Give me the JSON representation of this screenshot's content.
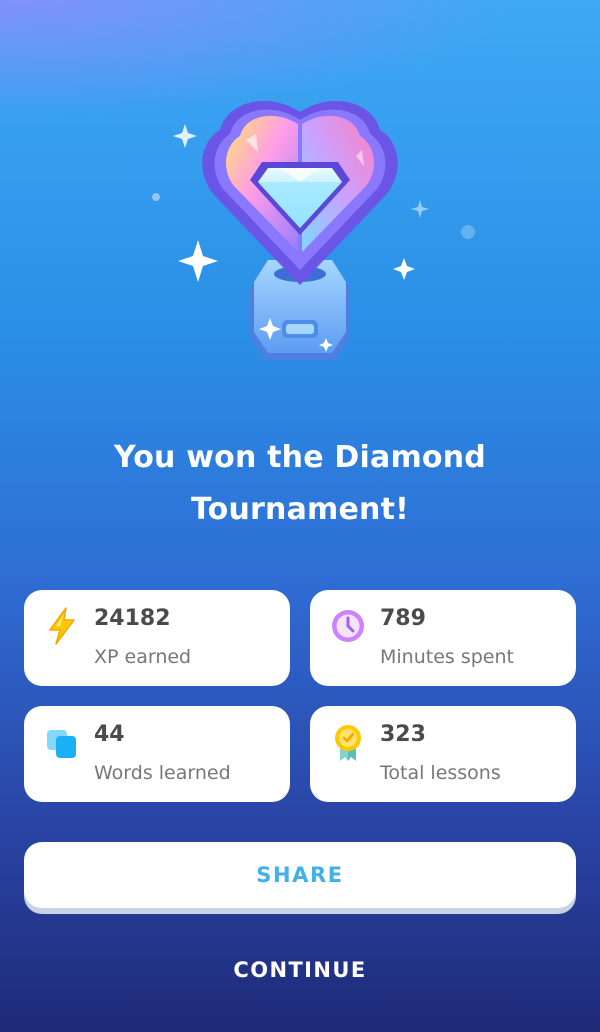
{
  "title_line1": "You won the Diamond",
  "title_line2": "Tournament!",
  "stats": [
    {
      "value": "24182",
      "label": "XP earned",
      "icon": "lightning-bolt-icon",
      "color": "#ffc800"
    },
    {
      "value": "789",
      "label": "Minutes spent",
      "icon": "clock-icon",
      "color": "#ce82ff"
    },
    {
      "value": "44",
      "label": "Words learned",
      "icon": "cards-icon",
      "color": "#1cb0f6"
    },
    {
      "value": "323",
      "label": "Total lessons",
      "icon": "medal-icon",
      "color": "#ffc800"
    }
  ],
  "share_label": "SHARE",
  "continue_label": "CONTINUE",
  "colors": {
    "background_top": "#3fa9f5",
    "background_bottom": "#1f2a78",
    "share_text": "#42b0ea"
  }
}
